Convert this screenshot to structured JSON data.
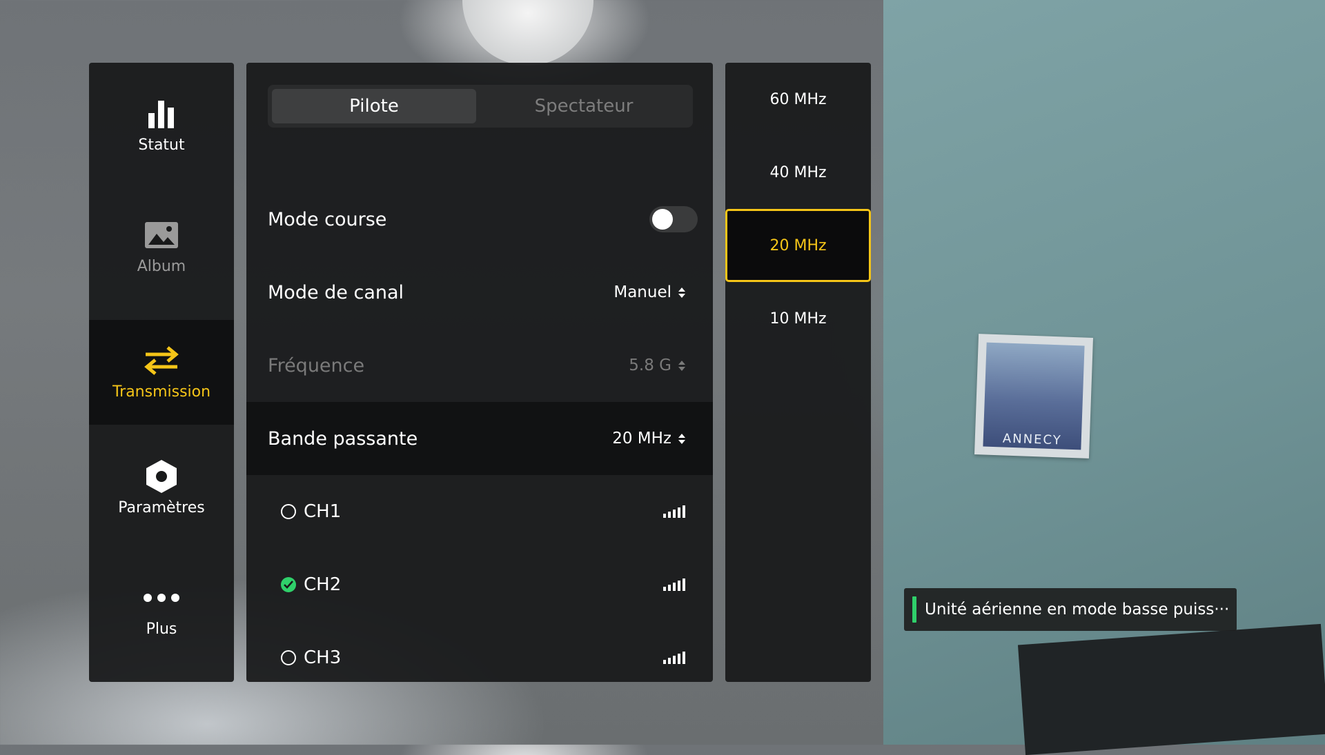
{
  "sidebar": {
    "items": [
      {
        "label": "Statut",
        "icon": "bar-chart-icon",
        "state": "normal"
      },
      {
        "label": "Album",
        "icon": "image-icon",
        "state": "dim"
      },
      {
        "label": "Transmission",
        "icon": "transfer-arrows-icon",
        "state": "active"
      },
      {
        "label": "Paramètres",
        "icon": "hex-nut-icon",
        "state": "normal"
      },
      {
        "label": "Plus",
        "icon": "more-dots-icon",
        "state": "normal"
      }
    ]
  },
  "main": {
    "tabs": [
      {
        "label": "Pilote",
        "selected": true
      },
      {
        "label": "Spectateur",
        "selected": false
      }
    ],
    "mode_course": {
      "label": "Mode course",
      "on": false
    },
    "mode_canal": {
      "label": "Mode de canal",
      "value": "Manuel"
    },
    "frequence": {
      "label": "Fréquence",
      "value": "5.8 G",
      "disabled": true
    },
    "bande_passante": {
      "label": "Bande passante",
      "value": "20 MHz"
    },
    "channels": [
      {
        "label": "CH1",
        "selected": false
      },
      {
        "label": "CH2",
        "selected": true
      },
      {
        "label": "CH3",
        "selected": false
      }
    ]
  },
  "bandwidth_options": {
    "items": [
      "60 MHz",
      "40 MHz",
      "20 MHz",
      "10 MHz"
    ],
    "selected": "20 MHz"
  },
  "toast": {
    "message": "Unité aérienne en mode basse puiss···"
  },
  "background": {
    "poster_text": "ANNECY"
  },
  "colors": {
    "accent": "#f5c518",
    "success": "#2fd06a",
    "panel": "#18191a"
  }
}
